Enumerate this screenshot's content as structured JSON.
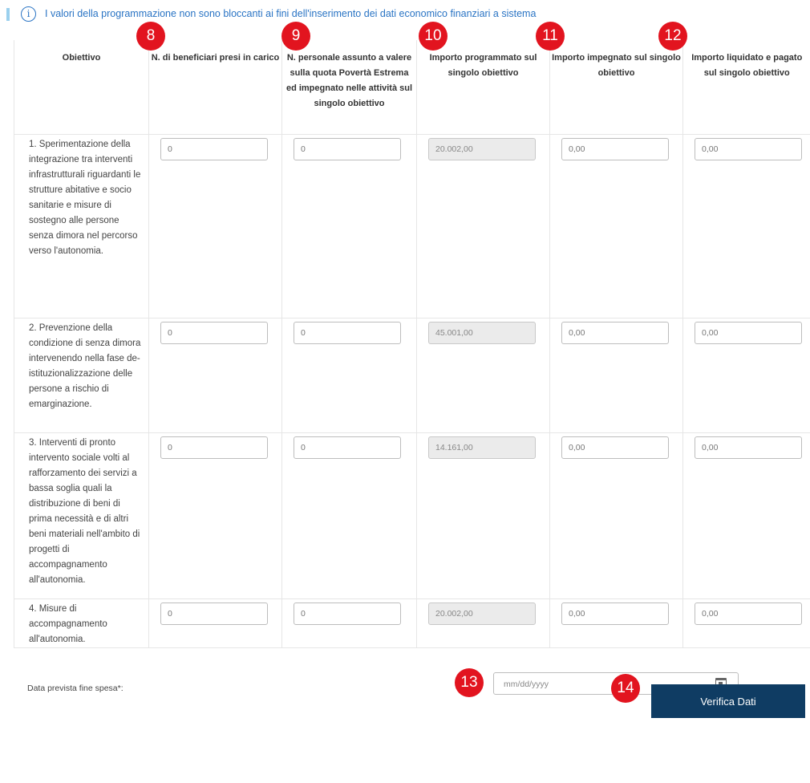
{
  "notice": {
    "icon": "info-circle-icon",
    "text": "I valori della programmazione non sono bloccanti ai fini dell'inserimento dei dati economico finanziari a sistema"
  },
  "table": {
    "headers": [
      "Obiettivo",
      "N. di beneficiari presi in carico",
      "N. personale assunto a valere sulla quota Povertà Estrema ed impegnato nelle attività sul singolo obiettivo",
      "Importo programmato sul singolo obiettivo",
      "Importo impegnato sul singolo obiettivo",
      "Importo liquidato e pagato sul singolo obiettivo"
    ],
    "rows": [
      {
        "objective": "1. Sperimentazione della integrazione tra interventi infrastrutturali riguardanti le strutture abitative e socio sanitarie e misure di sostegno alle persone senza dimora nel percorso verso l'autonomia.",
        "beneficiari": "0",
        "personale": "0",
        "programmato": "20.002,00",
        "impegnato": "0,00",
        "liquidato": "0,00"
      },
      {
        "objective": "2. Prevenzione della condizione di senza dimora intervenendo nella fase de-istituzionalizzazione delle persone a rischio di emarginazione.",
        "beneficiari": "0",
        "personale": "0",
        "programmato": "45.001,00",
        "impegnato": "0,00",
        "liquidato": "0,00"
      },
      {
        "objective": "3. Interventi di pronto intervento sociale volti al rafforzamento dei servizi a bassa soglia quali la distribuzione di beni di prima necessità e di altri beni materiali nell'ambito di progetti di accompagnamento all'autonomia.",
        "beneficiari": "0",
        "personale": "0",
        "programmato": "14.161,00",
        "impegnato": "0,00",
        "liquidato": "0,00"
      },
      {
        "objective": "4. Misure di accompagnamento all'autonomia.",
        "beneficiari": "0",
        "personale": "0",
        "programmato": "20.002,00",
        "impegnato": "0,00",
        "liquidato": "0,00"
      }
    ]
  },
  "date": {
    "label": "Data prevista fine spesa*:",
    "placeholder": "mm/dd/yyyy",
    "icon": "calendar-icon"
  },
  "verify_button": {
    "label": "Verifica Dati"
  },
  "markers": [
    "8",
    "9",
    "10",
    "11",
    "12",
    "13",
    "14"
  ],
  "colors": {
    "marker": "#e2141f",
    "button": "#0f3c63",
    "notice": "#2a74c4"
  }
}
